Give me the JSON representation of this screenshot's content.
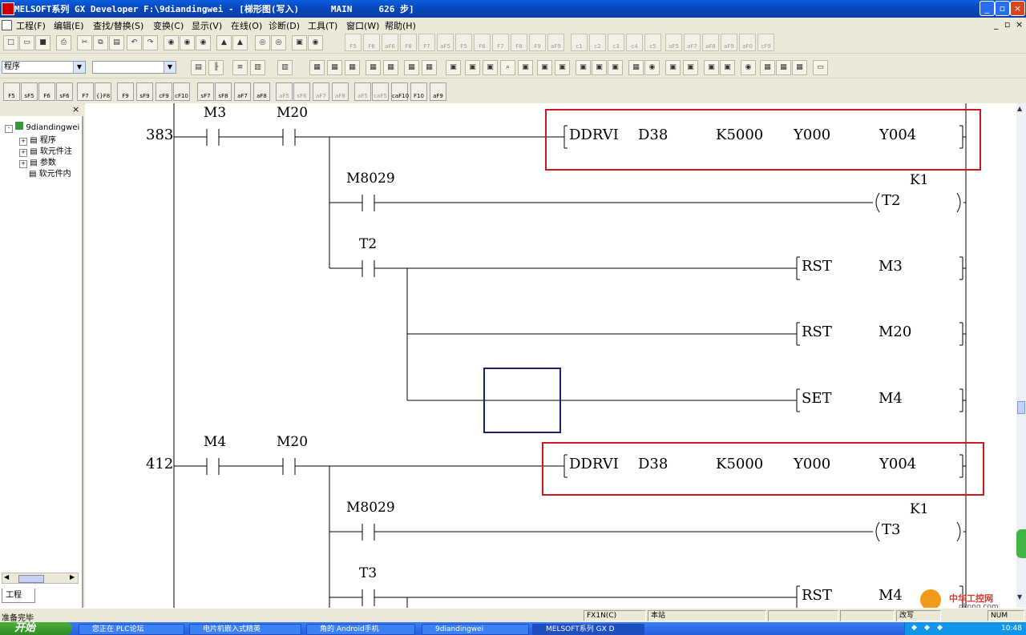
{
  "window": {
    "title": "MELSOFT系列 GX Developer F:\\9diandingwei - [梯形图(写入)      MAIN     626 步]",
    "min": "_",
    "max": "▫",
    "close": "×"
  },
  "menu": [
    "工程(F)",
    "编辑(E)",
    "查找/替换(S)",
    "变换(C)",
    "显示(V)",
    "在线(O)",
    "诊断(D)",
    "工具(T)",
    "窗口(W)",
    "帮助(H)"
  ],
  "mdi_controls": [
    "_",
    "▫",
    "×"
  ],
  "toolbar": {
    "program_combo": "程序",
    "second_combo": "",
    "fkeys_row1": [
      "F5",
      "F6",
      "aF6",
      "F8",
      "F7",
      "aF5",
      "F5",
      "F6",
      "F7",
      "F8",
      "F9",
      "aF9",
      "c1",
      "c2",
      "c3",
      "c4",
      "c5",
      "aF5",
      "aF7",
      "aF8",
      "aF9",
      "aF0",
      "cF9"
    ],
    "fkeys_row3": [
      "F5",
      "sF5",
      "F6",
      "sF6",
      "F7",
      "{}F8",
      "F9",
      "sF9",
      "cF9",
      "cF10",
      "sF7",
      "sF8",
      "aF7",
      "aF8",
      "aF5",
      "sF6",
      "aF7",
      "aF8",
      "aF5",
      "caF5",
      "caF10",
      "F10",
      "aF9"
    ]
  },
  "sidebar": {
    "root": "9diandingwei",
    "items": [
      "程序",
      "软元件注",
      "参数",
      "软元件内"
    ],
    "tab": "工程"
  },
  "ladder": {
    "rungs": [
      {
        "step": "383",
        "contacts": [
          "M3",
          "M20"
        ],
        "instr": {
          "op": "DDRVI",
          "args": [
            "D38",
            "K5000",
            "Y000",
            "Y004"
          ]
        },
        "branches": [
          {
            "contact": "M8029",
            "coil": "T2",
            "const": "K1"
          },
          {
            "contact": "T2",
            "instr": {
              "op": "RST",
              "arg": "M3"
            }
          },
          {
            "instr": {
              "op": "RST",
              "arg": "M20"
            }
          },
          {
            "instr": {
              "op": "SET",
              "arg": "M4"
            }
          }
        ]
      },
      {
        "step": "412",
        "contacts": [
          "M4",
          "M20"
        ],
        "instr": {
          "op": "DDRVI",
          "args": [
            "D38",
            "K5000",
            "Y000",
            "Y004"
          ]
        },
        "branches": [
          {
            "contact": "M8029",
            "coil": "T3",
            "const": "K1"
          },
          {
            "contact": "T3",
            "instr": {
              "op": "RST",
              "arg": "M4"
            }
          }
        ]
      }
    ]
  },
  "status": {
    "ready": "准备完毕",
    "plc": "FX1N(C)",
    "station": "本站",
    "mode": "改写",
    "num": "NUM"
  },
  "taskbar": {
    "start": "开始",
    "tasks": [
      "您正在 PLC论坛",
      "电片机嵌入式精英",
      "角的 Android手机",
      "9diandingwei",
      "MELSOFT系列 GX D"
    ],
    "clock": "10:48"
  },
  "watermark": {
    "text": "中华工控网",
    "url": "gkong.com"
  }
}
